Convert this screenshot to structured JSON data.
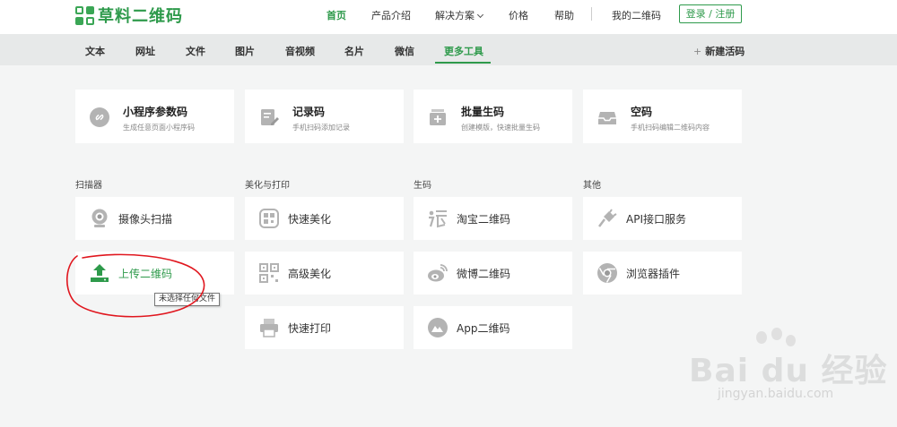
{
  "logo": {
    "text": "草料二维码"
  },
  "nav": {
    "items": [
      {
        "label": "首页"
      },
      {
        "label": "产品介绍"
      },
      {
        "label": "解决方案"
      },
      {
        "label": "价格"
      },
      {
        "label": "帮助"
      },
      {
        "label": "我的二维码"
      }
    ],
    "login_label": "登录 / 注册"
  },
  "subnav": {
    "tabs": [
      {
        "label": "文本"
      },
      {
        "label": "网址"
      },
      {
        "label": "文件"
      },
      {
        "label": "图片"
      },
      {
        "label": "音视频"
      },
      {
        "label": "名片"
      },
      {
        "label": "微信"
      },
      {
        "label": "更多工具"
      }
    ],
    "new_label": "新建活码"
  },
  "top_tools": [
    {
      "title": "小程序参数码",
      "desc": "生成任意页面小程序码",
      "icon": "link-icon"
    },
    {
      "title": "记录码",
      "desc": "手机扫码添加记录",
      "icon": "edit-record-icon"
    },
    {
      "title": "批量生码",
      "desc": "创建模版，快速批量生码",
      "icon": "batch-icon"
    },
    {
      "title": "空码",
      "desc": "手机扫码编辑二维码内容",
      "icon": "inbox-icon"
    }
  ],
  "sections": {
    "scanner": "扫描器",
    "beautify": "美化与打印",
    "generate": "生码",
    "other": "其他"
  },
  "scanner": [
    {
      "label": "摄像头扫描",
      "icon": "camera-icon"
    },
    {
      "label": "上传二维码",
      "icon": "upload-icon"
    }
  ],
  "beautify": [
    {
      "label": "快速美化",
      "icon": "qr-beautify-icon"
    },
    {
      "label": "高级美化",
      "icon": "qr-code-icon"
    },
    {
      "label": "快速打印",
      "icon": "printer-icon"
    }
  ],
  "generate": [
    {
      "label": "淘宝二维码",
      "icon": "taobao-icon"
    },
    {
      "label": "微博二维码",
      "icon": "weibo-icon"
    },
    {
      "label": "App二维码",
      "icon": "app-icon"
    }
  ],
  "other": [
    {
      "label": "API接口服务",
      "icon": "plug-icon"
    },
    {
      "label": "浏览器插件",
      "icon": "chrome-icon"
    }
  ],
  "tooltip": "未选择任何文件",
  "watermark": {
    "brand": "Bai du 经验",
    "url": "jingyan.baidu.com"
  },
  "colors": {
    "accent": "#2e9a4b",
    "icon_gray": "#b3b3b3",
    "annotation": "#e0161e"
  }
}
